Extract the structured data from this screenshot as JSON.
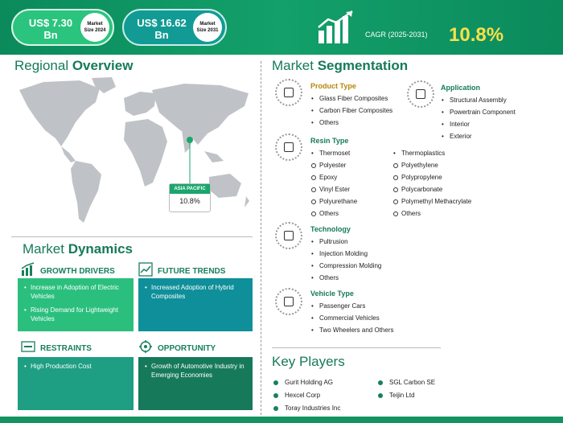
{
  "header": {
    "pill1": {
      "value": "US$ 7.30",
      "unit": "Bn",
      "circle_l1": "Market",
      "circle_l2": "Size 2024"
    },
    "pill2": {
      "value": "US$ 16.62",
      "unit": "Bn",
      "circle_l1": "Market",
      "circle_l2": "Size 2031"
    },
    "cagr_label": "CAGR (2025-2031)",
    "cagr_value": "10.8%"
  },
  "regional": {
    "title_a": "Regional ",
    "title_b": "Overview",
    "region_label": "ASIA PACIFIC",
    "region_value": "10.8%"
  },
  "dynamics": {
    "title_a": "Market ",
    "title_b": "Dynamics",
    "growth": {
      "heading": "GROWTH DRIVERS",
      "items": [
        "Increase in Adoption of Electric Vehicles",
        "Rising Demand for Lightweight Vehicles"
      ]
    },
    "trends": {
      "heading": "FUTURE TRENDS",
      "items": [
        "Increased Adoption of Hybrid Composites"
      ]
    },
    "restraints": {
      "heading": "RESTRAINTS",
      "items": [
        "High Production Cost"
      ]
    },
    "opportunity": {
      "heading": "OPPORTUNITY",
      "items": [
        "Growth of Automotive Industry in Emerging Economies"
      ]
    }
  },
  "segmentation": {
    "title_a": "Market ",
    "title_b": "Segmentation",
    "product": {
      "heading": "Product Type",
      "items": [
        "Glass Fiber Composites",
        "Carbon Fiber Composites",
        "Others"
      ]
    },
    "application": {
      "heading": "Application",
      "items": [
        "Structural Assembly",
        "Powertrain Component",
        "Interior",
        "Exterior"
      ]
    },
    "resin": {
      "heading": "Resin Type",
      "thermoset": "Thermoset",
      "thermoset_items": [
        "Polyester",
        "Epoxy",
        "Vinyl Ester",
        "Polyurethane",
        "Others"
      ],
      "thermoplastics": "Thermoplastics",
      "thermoplastics_items": [
        "Polyethylene",
        "Polypropylene",
        "Polycarbonate",
        "Polymethyl Methacrylate",
        "Others"
      ]
    },
    "technology": {
      "heading": "Technology",
      "items": [
        "Pultrusion",
        "Injection Molding",
        "Compression Molding",
        "Others"
      ]
    },
    "vehicle": {
      "heading": "Vehicle Type",
      "items": [
        "Passenger Cars",
        "Commercial Vehicles",
        "Two Wheelers and Others"
      ]
    }
  },
  "key_players": {
    "title": "Key Players",
    "col1": [
      "Gurit Holding AG",
      "Hexcel Corp",
      "Toray Industries Inc"
    ],
    "col2": [
      "SGL Carbon SE",
      "Teijin Ltd"
    ]
  },
  "colors": {
    "brand_green": "#12935f",
    "accent_yellow": "#f7e04a",
    "heading_green": "#167a5a"
  }
}
